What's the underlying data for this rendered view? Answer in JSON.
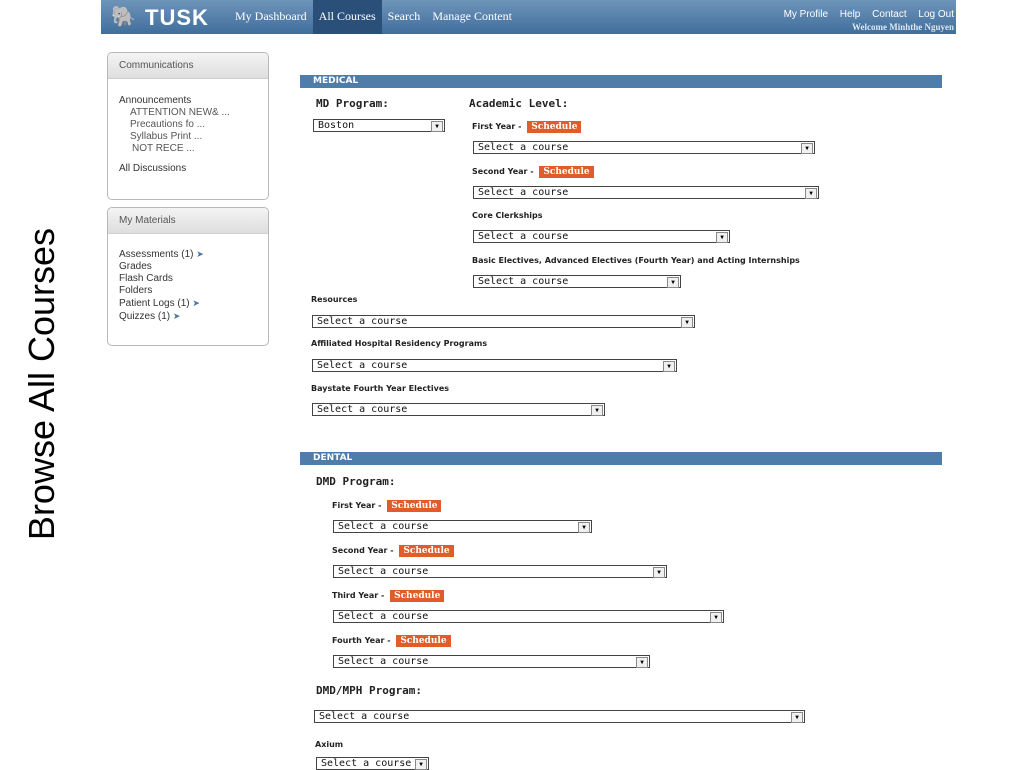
{
  "caption": "Browse All Courses",
  "header": {
    "logo": "TUSK",
    "nav": [
      "My Dashboard",
      "All Courses",
      "Search",
      "Manage Content"
    ],
    "user_links": [
      "My Profile",
      "Help",
      "Contact",
      "Log Out"
    ],
    "welcome": "Welcome Minhthe Nguyen"
  },
  "sidebar": {
    "communications": {
      "title": "Communications",
      "announcements": "Announcements",
      "items": [
        "ATTENTION NEW& ...",
        "Precautions fo ...",
        "Syllabus Print ...",
        "NOT RECE ..."
      ],
      "discussions": "All Discussions"
    },
    "materials": {
      "title": "My Materials",
      "items": [
        "Assessments (1)",
        "Grades",
        "Flash Cards",
        "Folders",
        "Patient Logs (1)",
        "Quizzes (1)"
      ]
    }
  },
  "medical": {
    "bar": "MEDICAL",
    "program_label": "MD Program:",
    "program_value": "Boston",
    "level_label": "Academic Level:",
    "first_year": "First Year - ",
    "second_year": "Second Year - ",
    "schedule": "Schedule",
    "core": "Core Clerkships",
    "electives": "Basic Electives, Advanced Electives (Fourth Year) and Acting Internships",
    "resources": "Resources",
    "affiliated": "Affiliated Hospital Residency Programs",
    "baystate": "Baystate Fourth Year Electives",
    "select_placeholder": "Select a course"
  },
  "dental": {
    "bar": "DENTAL",
    "dmd_label": "DMD Program:",
    "first_year": "First Year - ",
    "second_year": "Second Year - ",
    "third_year": "Third Year - ",
    "fourth_year": "Fourth Year - ",
    "schedule": "Schedule",
    "mph_label": "DMD/MPH Program:",
    "axium": "Axium",
    "select_placeholder": "Select a course"
  }
}
